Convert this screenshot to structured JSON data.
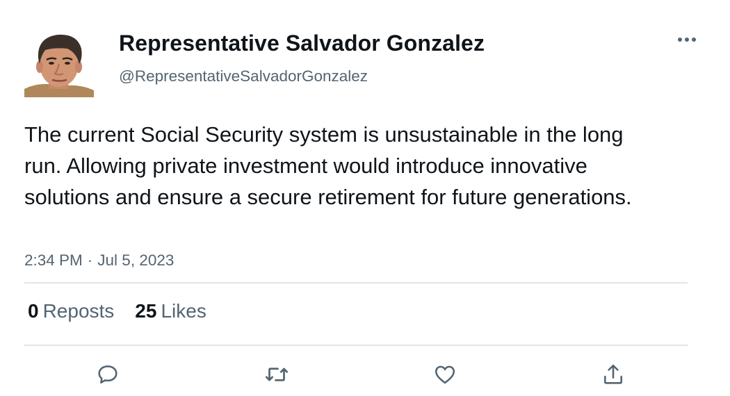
{
  "author": {
    "display_name": "Representative Salvador Gonzalez",
    "handle": "@RepresentativeSalvadorGonzalez",
    "avatar_icon": "profile-photo"
  },
  "tweet": {
    "text": "The current Social Security system is unsustainable in the long run. Allowing private investment would introduce innovative solutions and ensure a secure retirement for future generations.",
    "time": "2:34 PM",
    "separator": "·",
    "date": "Jul 5, 2023"
  },
  "stats": {
    "reposts_count": "0",
    "reposts_label": "Reposts",
    "likes_count": "25",
    "likes_label": "Likes"
  },
  "actions": {
    "more_icon": "more-horizontal-icon",
    "reply_icon": "reply-icon",
    "repost_icon": "repost-icon",
    "like_icon": "heart-icon",
    "share_icon": "share-icon"
  },
  "colors": {
    "text_primary": "#0f1419",
    "text_secondary": "#536471",
    "icon_gray": "#536471",
    "divider": "#e1e4e8"
  }
}
